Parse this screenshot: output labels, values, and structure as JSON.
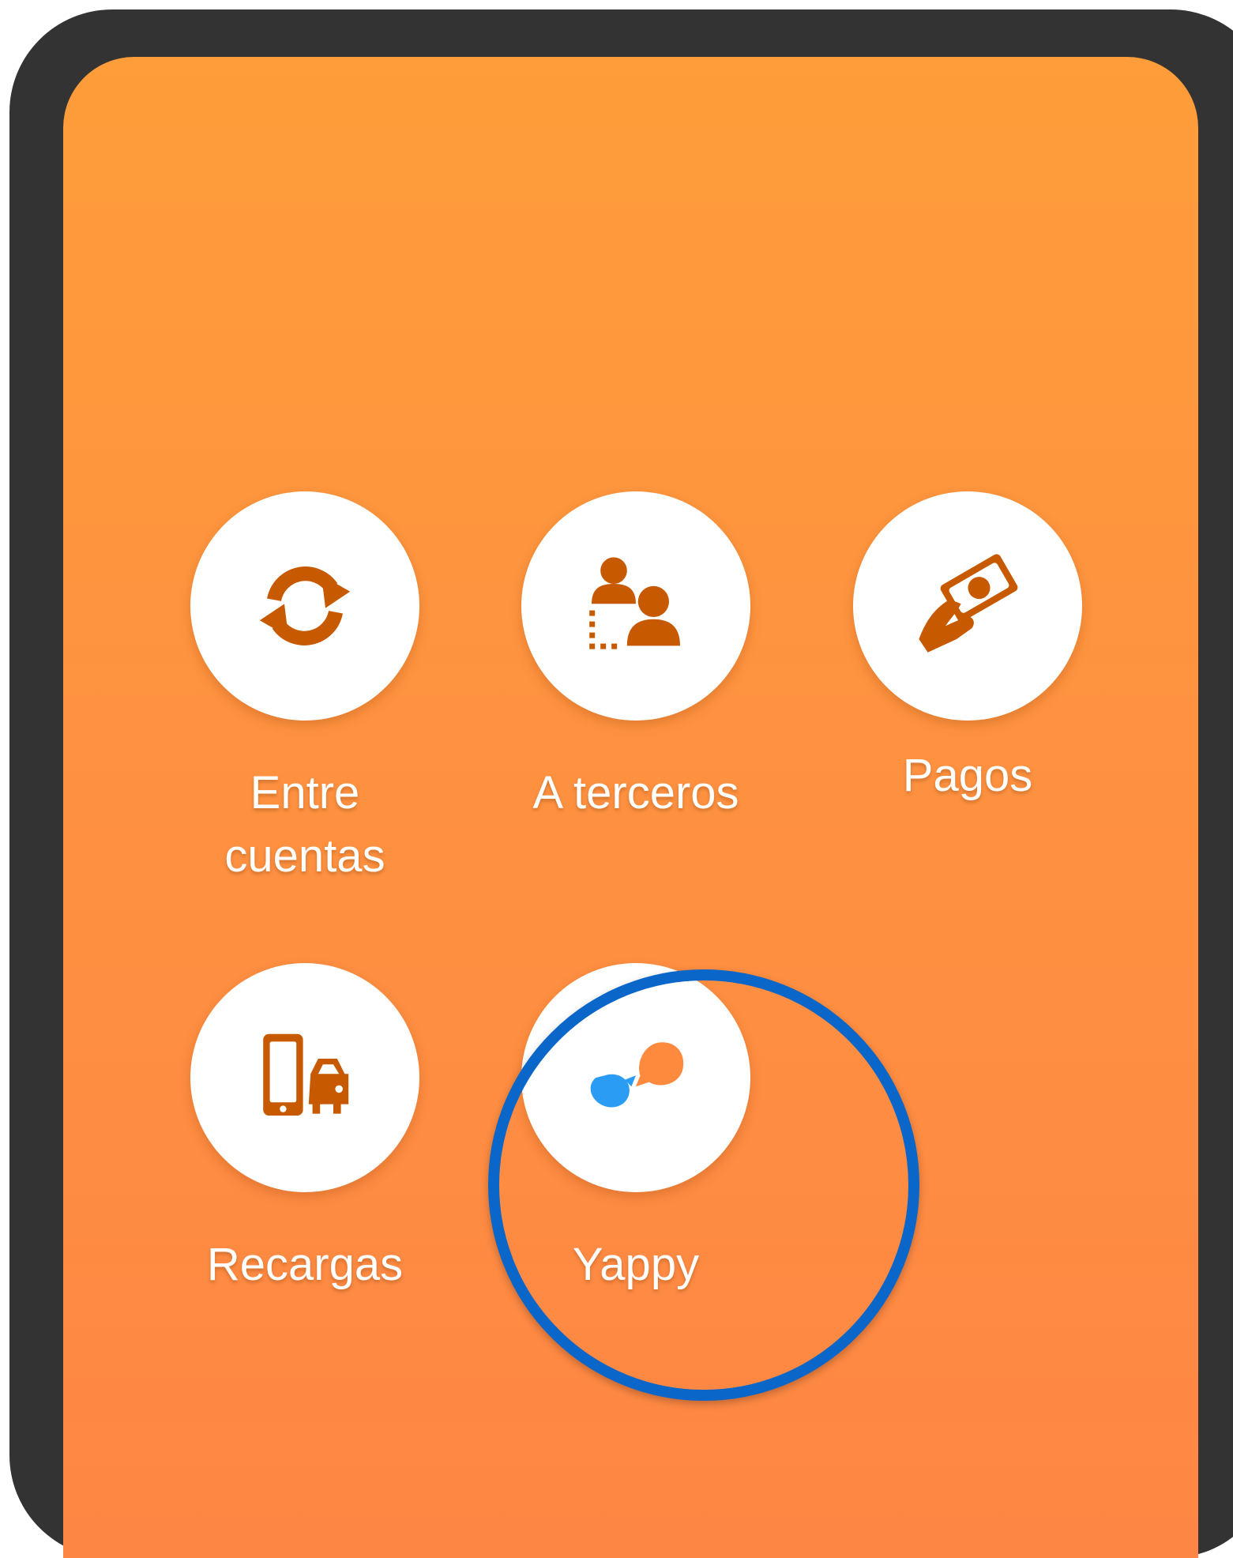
{
  "colors": {
    "frame": "#333333",
    "background_top": "#fe9d3a",
    "background_bottom": "#fe8644",
    "icon": "#c75a00",
    "yappy_blue": "#2a9cf3",
    "yappy_orange": "#fe8a3e",
    "highlight_ring": "#0a66c8"
  },
  "menu": {
    "items": [
      {
        "key": "entre-cuentas",
        "label_line1": "Entre",
        "label_line2": "cuentas",
        "icon": "sync-arrows-icon"
      },
      {
        "key": "a-terceros",
        "label_line1": "A terceros",
        "icon": "users-transfer-icon"
      },
      {
        "key": "pagos",
        "label_line1": "Pagos",
        "icon": "hand-money-icon"
      },
      {
        "key": "recargas",
        "label_line1": "Recargas",
        "icon": "phone-car-icon"
      },
      {
        "key": "yappy",
        "label_line1": "Yappy",
        "icon": "yappy-logo-icon",
        "highlighted": true
      }
    ]
  }
}
